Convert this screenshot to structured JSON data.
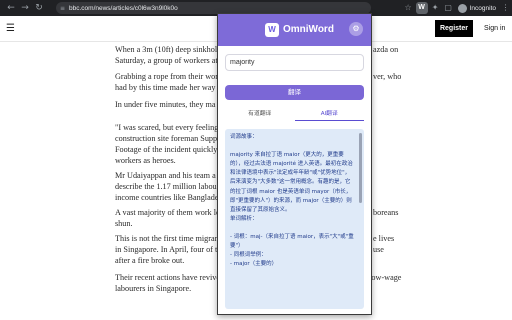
{
  "browser": {
    "url": "bbc.com/news/articles/c0l6w3n9l0k0o",
    "incognito_label": "Incognito",
    "icons": [
      "back-icon",
      "forward-icon",
      "reload-icon",
      "tune-icon",
      "bookmark-icon",
      "extension-omniword-icon",
      "extensions-icon",
      "profile-icon",
      "menu-icon"
    ]
  },
  "site": {
    "register_label": "Register",
    "signin_label": "Sign in"
  },
  "article": {
    "paragraphs": [
      "When a 3m (10ft) deep sinkhol\nSaturday, a group of workers at",
      "Grabbing a rope from their wor\nhad by this time made her way",
      "In under five minutes, they ma",
      "\"I was scared, but every feeling\nconstruction site foreman Supp",
      "Footage of the incident quickly\nworkers as heroes.",
      "Mr Udaiyappan and his team a\ndescribe the 1.17 million labou\nincome countries like Banglade",
      "A vast majority of them work lo\nshun.",
      "This is not the first time migrar\nin Singapore. In April, four of t\nafter a fire broke out.",
      "Their recent actions have revived a debate on the rights – or lack thereof – of low-wage\nlabourers in Singapore."
    ],
    "right_fragments": [
      "azda on",
      "ver, who",
      "boreans",
      "e lives",
      "use"
    ]
  },
  "popup": {
    "brand": "OmniWord",
    "logo_letter": "W",
    "input_value": "majority",
    "translate_label": "翻译",
    "tabs": [
      "有道翻译",
      "AI翻译"
    ],
    "active_tab": 1,
    "result_text": "词源故事：\n\nmajority 来自拉丁语 maior（更大的，更重要的），经过古法语 majorité 进入英语。最初在政治和法律语境中表示\"法定成年年龄\"或\"优势地位\"，后来演变为\"大多数\"这一常用概念。有趣的是，它的拉丁词根 maior 也是英语单词 mayor（市长，即\"更重要的人\"）的来源，而 major（主要的）则直接保留了其原始含义。\n单词解析：\n\n- 词根：maj-（来自拉丁语 maior，表示\"大\"或\"重要\"）\n- 同根词举例：\n- major（主要的）"
  },
  "colors": {
    "header_purple": "#7e6bd8",
    "button_purple": "#7b67d6",
    "result_bg": "#dfeaf8",
    "result_text": "#1f3a8a",
    "chrome_bg": "#202124"
  }
}
